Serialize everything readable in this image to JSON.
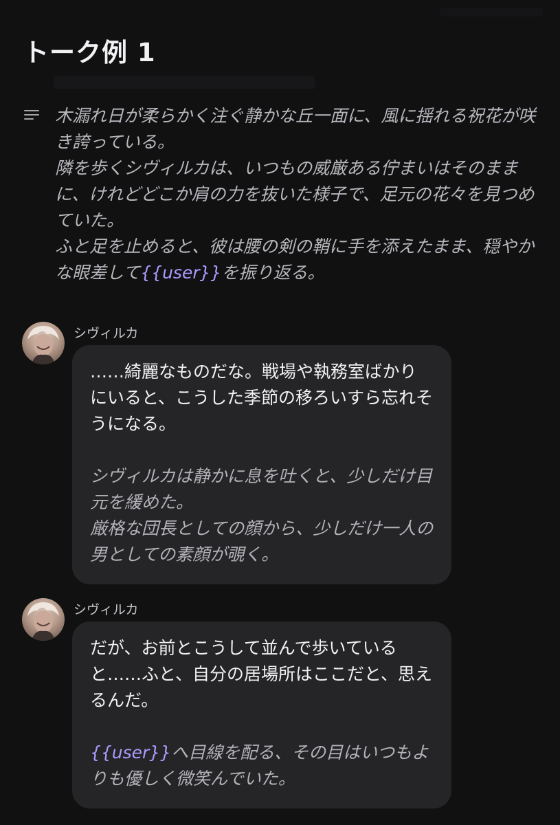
{
  "header": {
    "title": "トーク例 1"
  },
  "narration": {
    "line1": "木漏れ日が柔らかく注ぐ静かな丘一面に、風に揺れる祝花が咲き誇っている。",
    "line2": "隣を歩くシヴィルカは、いつもの威厳ある佇まいはそのままに、けれどどこか肩の力を抜いた様子で、足元の花々を見つめていた。",
    "line3_prefix": "ふと足を止めると、彼は腰の剣の鞘に手を添えたまま、穏やかな眼差して",
    "user_tag": "{{user}}",
    "line3_suffix": "を振り返る。"
  },
  "messages": [
    {
      "speaker": "シヴィルカ",
      "dialogue": "……綺麗なものだな。戦場や執務室ばかりにいると、こうした季節の移ろいすら忘れそうになる。",
      "action_line1": "シヴィルカは静かに息を吐くと、少しだけ目元を緩めた。",
      "action_line2": "厳格な団長としての顔から、少しだけ一人の男としての素顔が覗く。"
    },
    {
      "speaker": "シヴィルカ",
      "dialogue": "だが、お前とこうして並んで歩いていると……ふと、自分の居場所はここだと、思えるんだ。",
      "action_user_tag": "{{user}}",
      "action_suffix": "へ目線を配る、その目はいつもよりも優しく微笑んでいた。"
    }
  ],
  "icons": {
    "narration": "narration-lines-icon",
    "avatar": "character-avatar"
  },
  "colors": {
    "background": "#111112",
    "bubble": "#252527",
    "user_tag": "#a99bff"
  }
}
